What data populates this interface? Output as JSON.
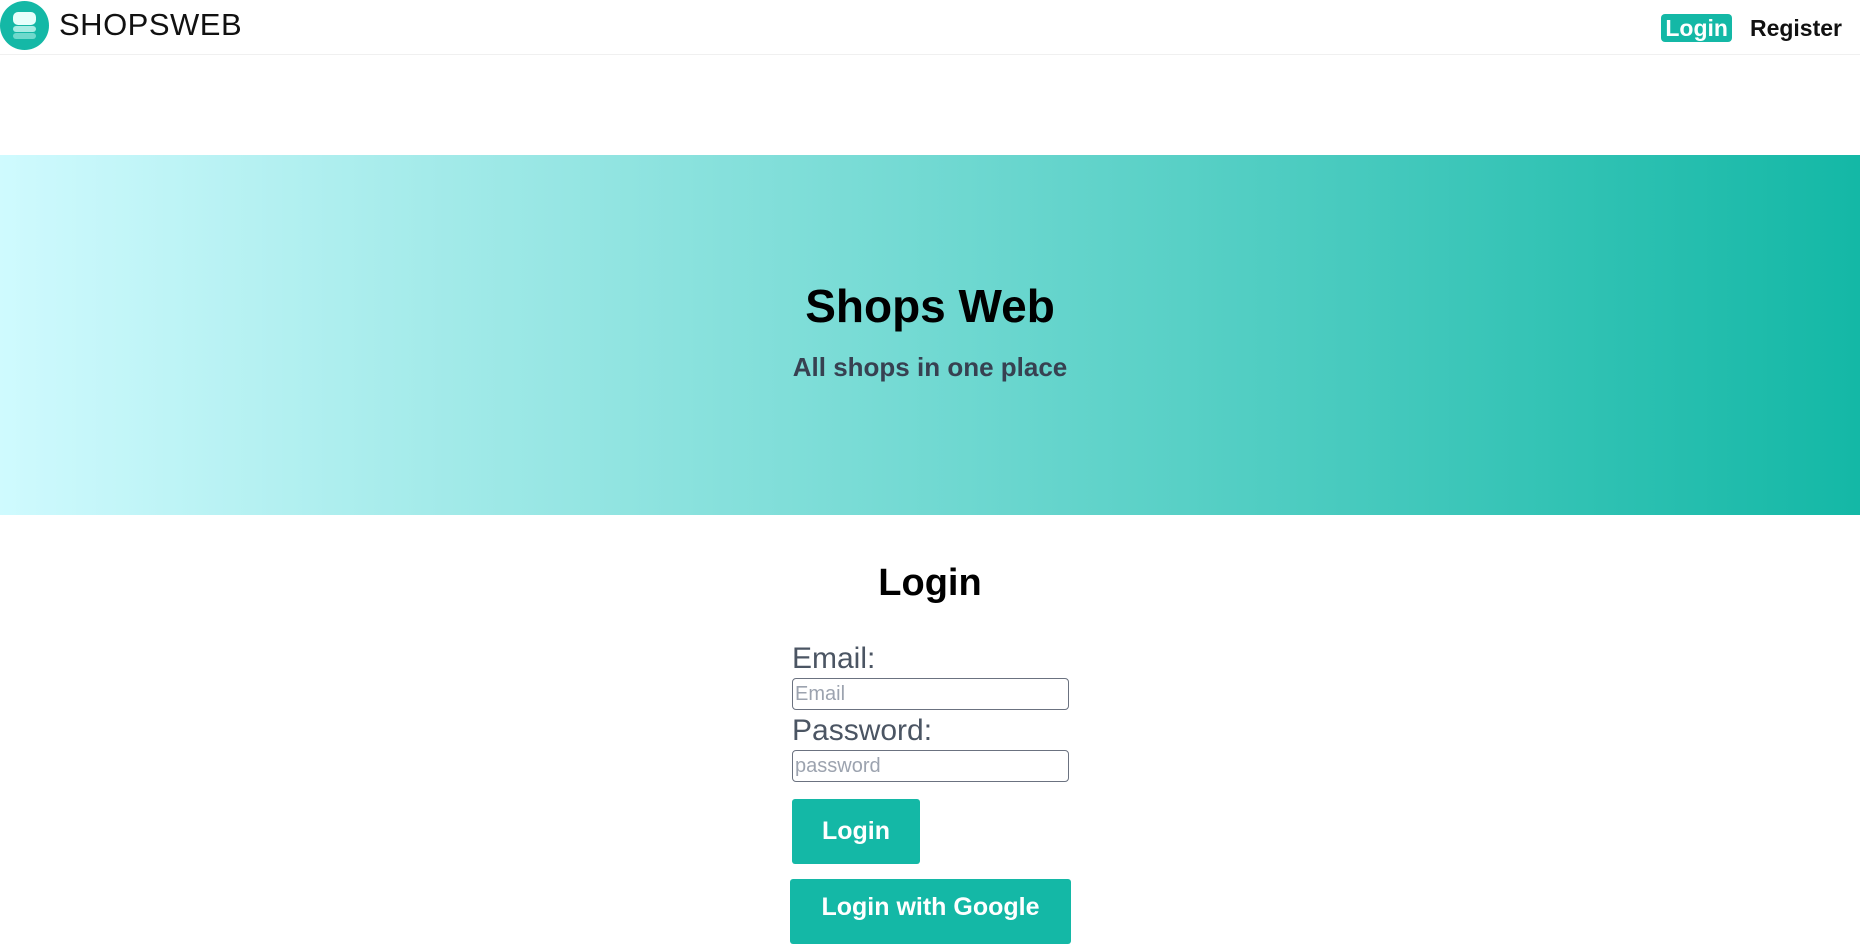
{
  "navbar": {
    "brand": {
      "logo_icon": "stacked-layers-logo-icon",
      "name": "SHOPSWEB"
    },
    "links": {
      "login": "Login",
      "register": "Register"
    }
  },
  "hero": {
    "title": "Shops Web",
    "subtitle": "All shops in one place"
  },
  "login_form": {
    "title": "Login",
    "email": {
      "label": "Email:",
      "placeholder": "Email",
      "value": ""
    },
    "password": {
      "label": "Password:",
      "placeholder": "password",
      "value": ""
    },
    "submit_label": "Login",
    "google_label": "Login with Google"
  },
  "colors": {
    "accent": "#14b8a6",
    "hero_gradient_start": "#cffafe",
    "hero_gradient_end": "#14b8a6",
    "label_text": "#4b5563"
  }
}
